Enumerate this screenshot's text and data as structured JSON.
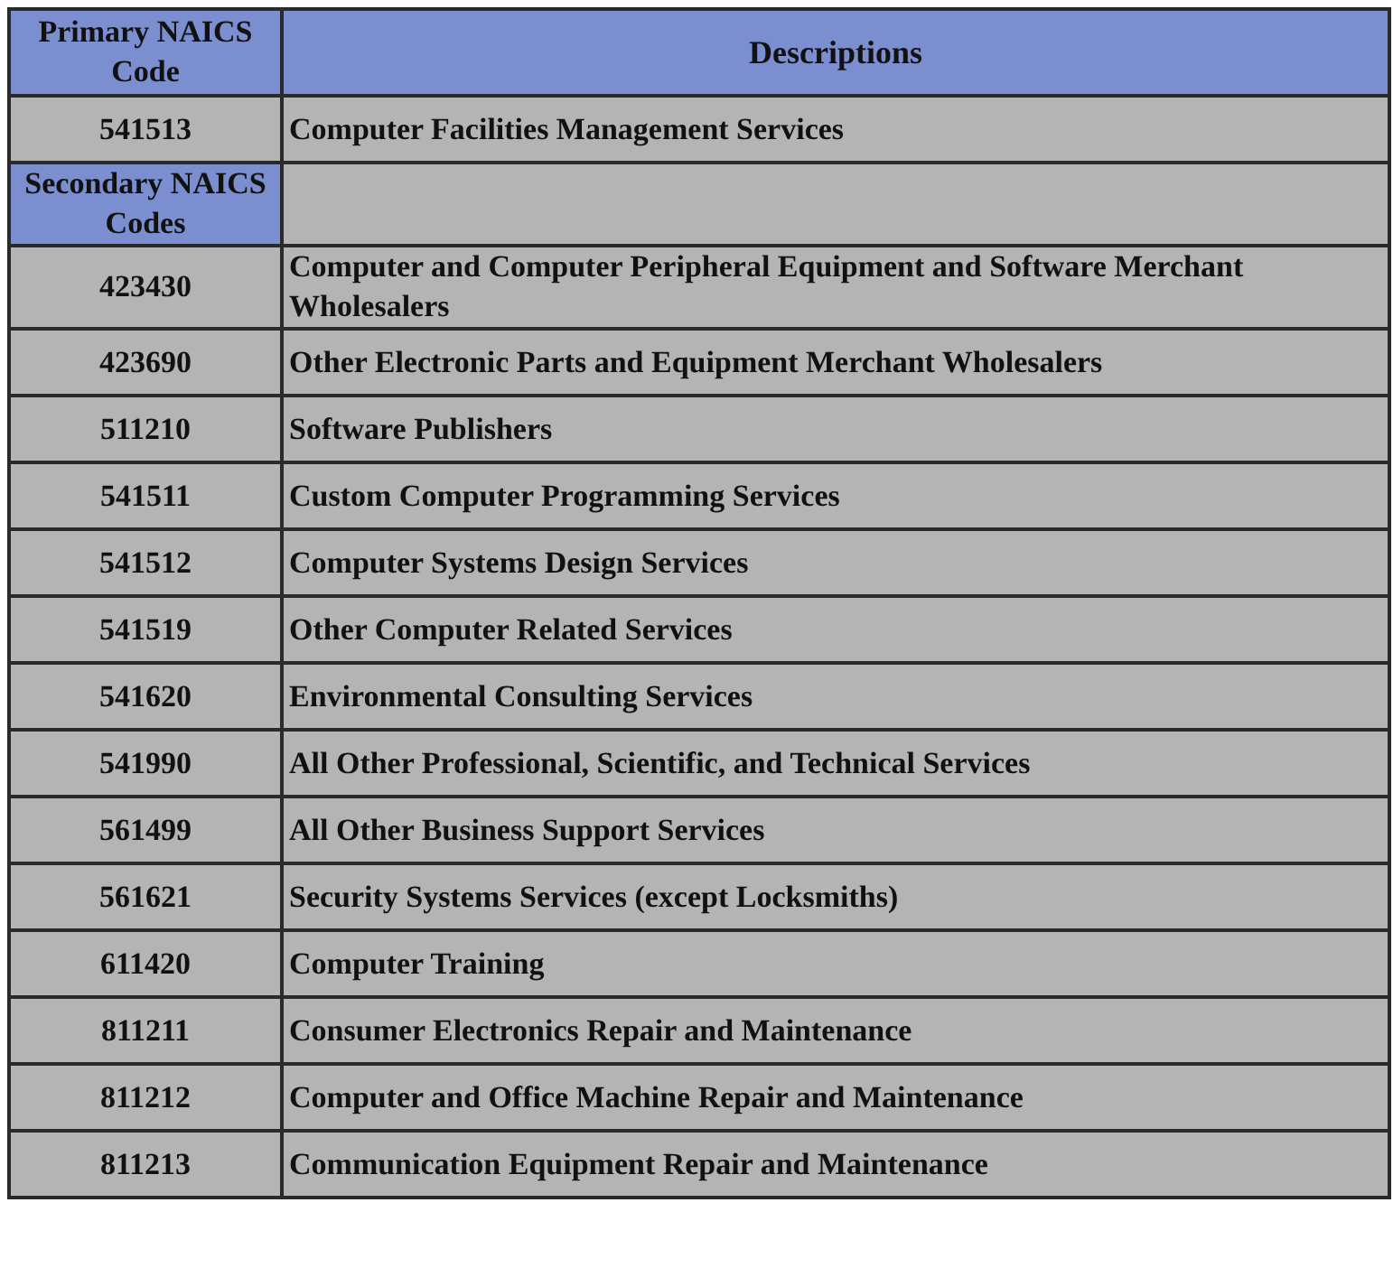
{
  "table": {
    "columns": [
      {
        "label": "Primary NAICS Code"
      },
      {
        "label": "Descriptions"
      }
    ],
    "rows": [
      {
        "kind": "data",
        "code": "541513",
        "description": "Computer Facilities Management Services"
      },
      {
        "kind": "subheading",
        "code": "Secondary NAICS Codes"
      },
      {
        "kind": "data",
        "code": "423430",
        "description": "Computer and Computer Peripheral Equipment and Software Merchant Wholesalers"
      },
      {
        "kind": "data",
        "code": "423690",
        "description": "Other Electronic Parts and Equipment Merchant Wholesalers"
      },
      {
        "kind": "data",
        "code": "511210",
        "description": "Software Publishers"
      },
      {
        "kind": "data",
        "code": "541511",
        "description": "Custom Computer Programming Services"
      },
      {
        "kind": "data",
        "code": "541512",
        "description": "Computer Systems Design Services"
      },
      {
        "kind": "data",
        "code": "541519",
        "description": "Other Computer Related Services"
      },
      {
        "kind": "data",
        "code": "541620",
        "description": "Environmental Consulting Services"
      },
      {
        "kind": "data",
        "code": "541990",
        "description": "All Other Professional, Scientific, and Technical Services"
      },
      {
        "kind": "data",
        "code": "561499",
        "description": "All Other Business Support Services"
      },
      {
        "kind": "data",
        "code": "561621",
        "description": "Security Systems Services (except Locksmiths)"
      },
      {
        "kind": "data",
        "code": "611420",
        "description": "Computer Training"
      },
      {
        "kind": "data",
        "code": "811211",
        "description": "Consumer Electronics Repair and Maintenance"
      },
      {
        "kind": "data",
        "code": "811212",
        "description": "Computer and Office Machine Repair and Maintenance"
      },
      {
        "kind": "data",
        "code": "811213",
        "description": "Communication Equipment Repair and Maintenance"
      }
    ]
  }
}
